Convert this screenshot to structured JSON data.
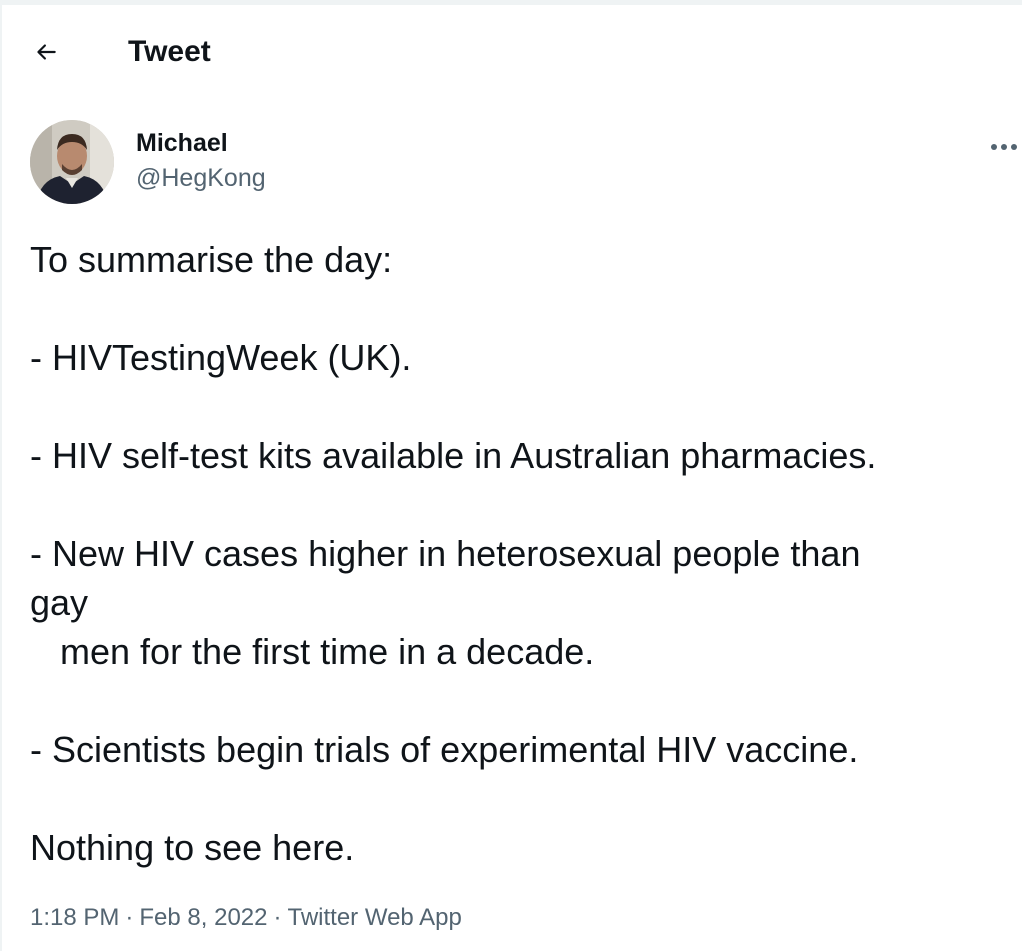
{
  "header": {
    "title": "Tweet",
    "back_icon": "arrow-left-icon"
  },
  "tweet": {
    "author": {
      "name": "Michael",
      "handle": "@HegKong"
    },
    "more_icon": "ellipsis-icon",
    "text_lines": [
      "To summarise the day:",
      "",
      "- HIVTestingWeek (UK).",
      "",
      "- HIV self-test kits available in Australian pharmacies.",
      "",
      "- New HIV cases higher in heterosexual people than",
      "gay",
      "   men for the first time in a decade.",
      "",
      "- Scientists begin trials of experimental HIV vaccine.",
      "",
      "Nothing to see here."
    ],
    "meta": {
      "time": "1:18 PM",
      "date": "Feb 8, 2022",
      "source": "Twitter Web App",
      "separator": "·"
    }
  },
  "colors": {
    "text_primary": "#0f1419",
    "text_secondary": "#536471",
    "border": "#eff3f4"
  }
}
